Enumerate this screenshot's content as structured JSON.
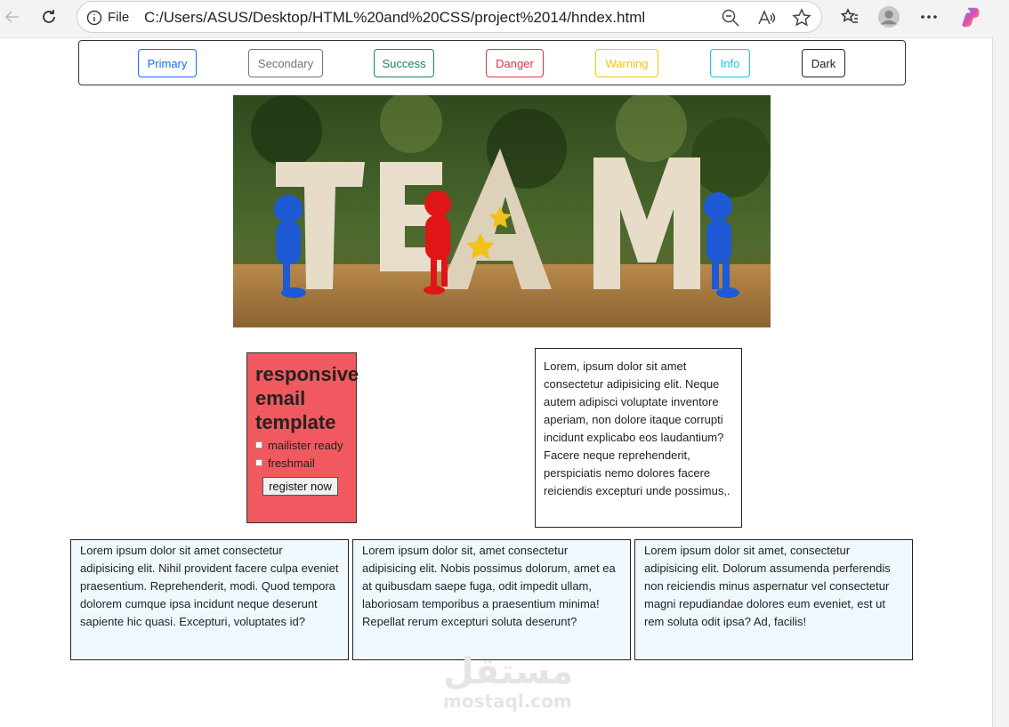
{
  "browser": {
    "file_label": "File",
    "url": "C:/Users/ASUS/Desktop/HTML%20and%20CSS/project%2014/hndex.html"
  },
  "buttons": [
    {
      "label": "Primary",
      "color": "#0d6efd"
    },
    {
      "label": "Secondary",
      "color": "#6c757d"
    },
    {
      "label": "Success",
      "color": "#198754"
    },
    {
      "label": "Danger",
      "color": "#dc3545"
    },
    {
      "label": "Warning",
      "color": "#ffc107"
    },
    {
      "label": "Info",
      "color": "#0dcaf0"
    },
    {
      "label": "Dark",
      "color": "#212529"
    }
  ],
  "hero_text": "TEAM",
  "email": {
    "title": "responsive email template",
    "option1": "mailister ready",
    "option2": "freshmail",
    "register": "register now"
  },
  "side_text": "Lorem, ipsum dolor sit amet consectetur adipisicing elit. Neque autem adipisci voluptate inventore aperiam, non dolore itaque corrupti incidunt explicabo eos laudantium? Facere neque reprehenderit, perspiciatis nemo dolores facere reiciendis excepturi unde possimus,.",
  "cards": [
    "Lorem ipsum dolor sit amet consectetur adipisicing elit. Nihil provident facere culpa eveniet praesentium. Reprehenderit, modi. Quod tempora dolorem cumque ipsa incidunt neque deserunt sapiente hic quasi. Excepturi, voluptates id?",
    "Lorem ipsum dolor sit, amet consectetur adipisicing elit. Nobis possimus dolorum, amet ea at quibusdam saepe fuga, odit impedit ullam, laboriosam temporibus a praesentium minima! Repellat rerum excepturi soluta deserunt?",
    "Lorem ipsum dolor sit amet, consectetur adipisicing elit. Dolorum assumenda perferendis non reiciendis minus aspernatur vel consectetur magni repudiandae dolores eum eveniet, est ut rem soluta odit ipsa? Ad, facilis!"
  ],
  "watermark": {
    "arabic": "مستقل",
    "latin": "mostaql.com"
  }
}
